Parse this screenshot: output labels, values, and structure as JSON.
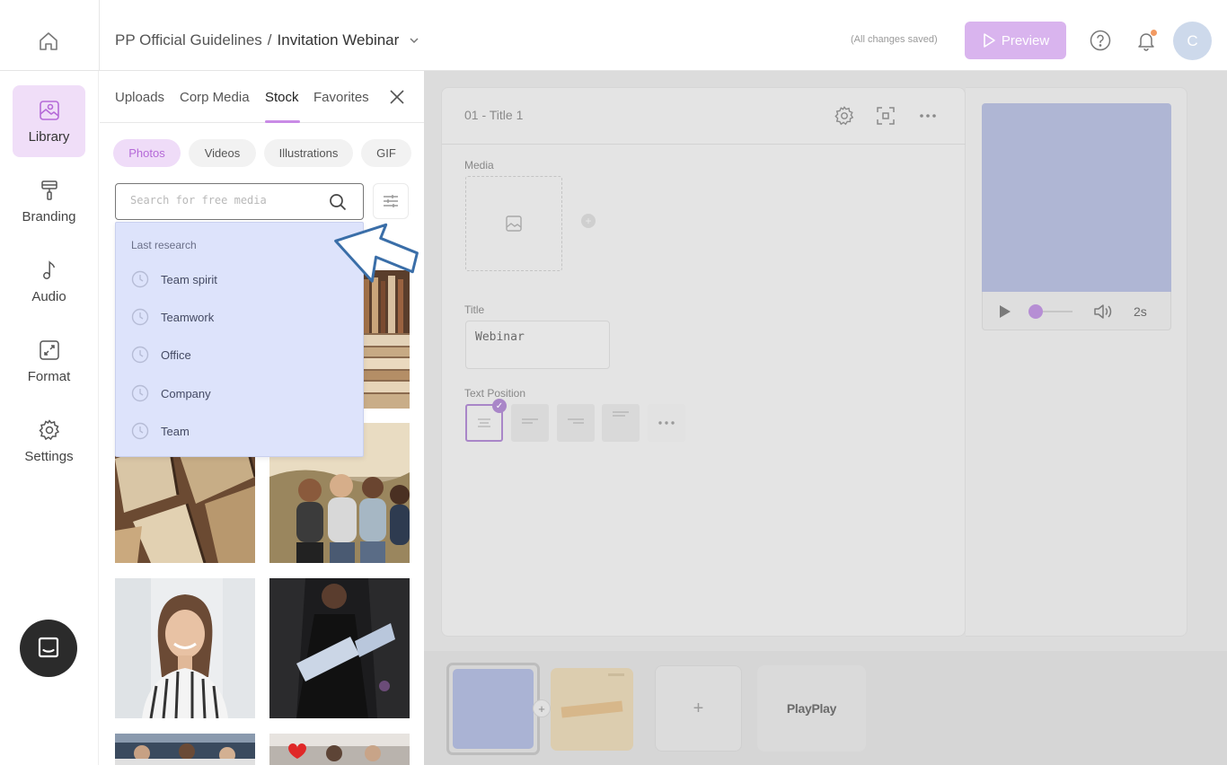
{
  "topbar": {
    "breadcrumb_parent": "PP Official Guidelines",
    "breadcrumb_separator": "/",
    "breadcrumb_current": "Invitation Webinar",
    "saved_status": "(All changes saved)",
    "preview_label": "Preview",
    "avatar_initial": "C",
    "accent_color": "#d9b4ee"
  },
  "rail": {
    "items": [
      {
        "label": "Library",
        "icon": "image-icon"
      },
      {
        "label": "Branding",
        "icon": "paint-roller-icon"
      },
      {
        "label": "Audio",
        "icon": "music-note-icon"
      },
      {
        "label": "Format",
        "icon": "resize-icon"
      },
      {
        "label": "Settings",
        "icon": "gear-icon"
      }
    ]
  },
  "library": {
    "tabs": [
      "Uploads",
      "Corp Media",
      "Stock",
      "Favorites"
    ],
    "active_tab": "Stock",
    "chips": [
      "Photos",
      "Videos",
      "Illustrations",
      "GIF"
    ],
    "active_chip": "Photos",
    "search_placeholder": "Search for free media",
    "recent": {
      "title": "Last research",
      "items": [
        "Team spirit",
        "Teamwork",
        "Office",
        "Company",
        "Team"
      ]
    }
  },
  "editor": {
    "scene_title": "01 - Title 1",
    "media_label": "Media",
    "title_label": "Title",
    "title_value": "Webinar",
    "text_position_label": "Text Position"
  },
  "player": {
    "duration": "2s"
  },
  "timeline": {
    "brand_label": "PlayPlay",
    "add_symbol": "+"
  }
}
